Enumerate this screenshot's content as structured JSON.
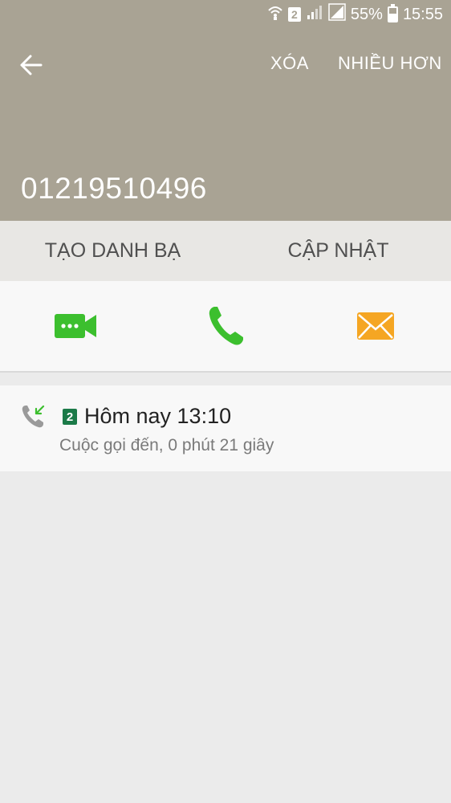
{
  "status_bar": {
    "sim_slot": "2",
    "battery": "55%",
    "time": "15:55",
    "icons": [
      "wifi-calling-icon",
      "sim-2-icon",
      "signal-icon",
      "signal-icon",
      "battery-icon"
    ]
  },
  "app_bar": {
    "back_icon": "arrow-left-icon",
    "delete_label": "XÓA",
    "more_label": "NHIỀU HƠN"
  },
  "contact": {
    "number": "01219510496"
  },
  "contact_actions": {
    "create_label": "TẠO DANH BẠ",
    "update_label": "CẬP NHẬT"
  },
  "communication": {
    "video_call_icon": "video-call-icon",
    "voice_call_icon": "phone-icon",
    "message_icon": "envelope-icon",
    "colors": {
      "video": "#3cbf2e",
      "call": "#3cbf2e",
      "message": "#f5a623"
    }
  },
  "history": [
    {
      "type_icon": "incoming-call-icon",
      "sim_slot": "2",
      "time": "Hôm nay 13:10",
      "detail": "Cuộc gọi đến, 0 phút 21 giây"
    }
  ],
  "colors": {
    "header_bg": "#a9a394",
    "sim_badge": "#1b7a48"
  }
}
